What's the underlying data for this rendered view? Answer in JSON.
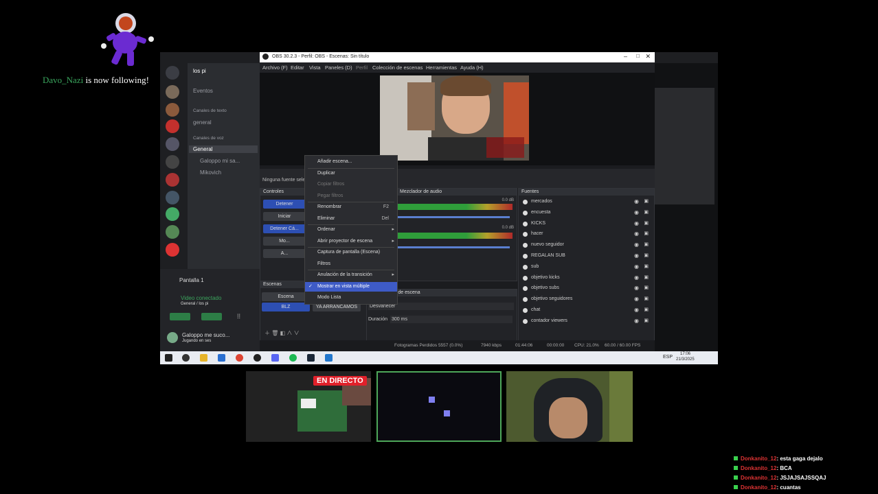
{
  "alert": {
    "username": "Davo_Nazi",
    "message": " is now following!"
  },
  "discord": {
    "server_name": "los pi",
    "events": "Eventos",
    "text_category": "Canales de texto",
    "general_text": "general",
    "voice_category": "Canales de voz",
    "voice_channel": "General",
    "voice_users": [
      "Galoppo mi sa...",
      "Mikovich"
    ],
    "screen_share": "Pantalla 1",
    "video_status": "Video conectado",
    "video_sub": "General / los pi",
    "user_name": "Galoppo me suco...",
    "user_status": "Jugando en ses"
  },
  "obs": {
    "title": "OBS 30.2.3 - Perfil: OBS - Escenas: Sin título",
    "menu": [
      "Archivo (F)",
      "Editar",
      "Vista",
      "Paneles (D)",
      "Perfil",
      "Colección de escenas",
      "Herramientas",
      "Ayuda (H)"
    ],
    "no_source": "Ninguna fuente seleccionada",
    "controls_header": "Controles",
    "controls_buttons": [
      "Detener",
      "Iniciar",
      "Detener Cá...",
      "Mo...",
      "A..."
    ],
    "audio_header": "Mezclador de audio",
    "audio_db": [
      "0.0 dB",
      "0.0 dB"
    ],
    "scenes_header": "Escenas",
    "scenes": [
      "Escena",
      "BLZ",
      "YA ARRANCAMOS"
    ],
    "transitions_header": "Transiciones de escena",
    "transition_value": "Desvanecer",
    "duration_label": "Duración",
    "duration_value": "300 ms",
    "sources_header": "Fuentes",
    "sources": [
      "mercados",
      "encuesta",
      "KICKS",
      "hacer",
      "nuevo seguidor",
      "REGALAN SUB",
      "sub",
      "objetivo kicks",
      "objetivo subs",
      "objetivo seguidores",
      "chat",
      "contador viewers"
    ],
    "status": {
      "frames": "Fotogramas Perdidos 5557 (0.0%)",
      "bitrate": "7940 kbps",
      "rec_time": "01:44:06",
      "stream_time": "00:00:00",
      "cpu": "CPU: 21.0%",
      "fps": "60.00 / 60.00 FPS"
    }
  },
  "context_menu": {
    "items": [
      {
        "label": "Añadir escena...",
        "shortcut": "",
        "disabled": false,
        "submenu": false
      },
      {
        "label": "Duplicar",
        "shortcut": "",
        "disabled": false,
        "submenu": false
      },
      {
        "label": "Copiar filtros",
        "shortcut": "",
        "disabled": true,
        "submenu": false
      },
      {
        "label": "Pegar filtros",
        "shortcut": "",
        "disabled": true,
        "submenu": false
      },
      {
        "label": "Renombrar",
        "shortcut": "F2",
        "disabled": false,
        "submenu": false
      },
      {
        "label": "Eliminar",
        "shortcut": "Del",
        "disabled": false,
        "submenu": false
      },
      {
        "label": "Ordenar",
        "shortcut": "",
        "disabled": false,
        "submenu": true
      },
      {
        "label": "Abrir proyector de escena",
        "shortcut": "",
        "disabled": false,
        "submenu": true
      },
      {
        "label": "Captura de pantalla (Escena)",
        "shortcut": "",
        "disabled": false,
        "submenu": false
      },
      {
        "label": "Filtros",
        "shortcut": "",
        "disabled": false,
        "submenu": false
      },
      {
        "label": "Anulación de la transición",
        "shortcut": "",
        "disabled": false,
        "submenu": true
      },
      {
        "label": "Mostrar en vista múltiple",
        "shortcut": "",
        "disabled": false,
        "submenu": false,
        "checked": true
      },
      {
        "label": "Modo Lista",
        "shortcut": "",
        "disabled": false,
        "submenu": false
      }
    ]
  },
  "taskbar": {
    "lang": "ESP",
    "time": "17:06",
    "date": "21/3/2025"
  },
  "live_badge": "EN DIRECTO",
  "chat": [
    {
      "user": "Donkanito_12",
      "message": ": esta gaga dejalo"
    },
    {
      "user": "Donkanito_12",
      "message": ": BCA"
    },
    {
      "user": "Donkanito_12",
      "message": ": JSJAJSAJSSQAJ"
    },
    {
      "user": "Donkanito_12",
      "message": ": cuantas"
    }
  ]
}
